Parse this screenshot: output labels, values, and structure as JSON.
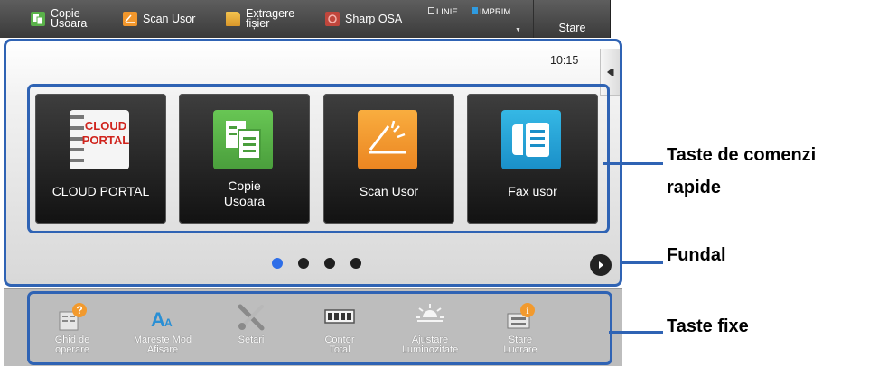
{
  "topbar": {
    "copy_label": "Copie\nUsoara",
    "scan_label": "Scan Usor",
    "extract_label": "Extragere\nfișier",
    "sharp_label": "Sharp OSA",
    "line_label": "LINIE",
    "print_label": "IMPRIM.",
    "status_label": "Stare"
  },
  "home": {
    "clock": "10:15",
    "tiles": [
      {
        "label": "CLOUD PORTAL",
        "icon": "cloud-portal-icon"
      },
      {
        "label": "Copie\nUsoara",
        "icon": "copy-icon"
      },
      {
        "label": "Scan Usor",
        "icon": "scan-icon"
      },
      {
        "label": "Fax usor",
        "icon": "fax-icon"
      }
    ],
    "cloud_logo_text": "CLOUD\nPORTAL",
    "pages": 4,
    "active_page": 1
  },
  "fixed_keys": [
    {
      "label": "Ghid de\noperare",
      "icon": "help-guide-icon"
    },
    {
      "label": "Mareste Mod\nAfisare",
      "icon": "zoom-text-icon"
    },
    {
      "label": "Setari",
      "icon": "settings-tools-icon"
    },
    {
      "label": "Contor\nTotal",
      "icon": "counter-icon"
    },
    {
      "label": "Ajustare\nLuminozitate",
      "icon": "brightness-icon"
    },
    {
      "label": "Stare\nLucrare",
      "icon": "job-status-icon"
    }
  ],
  "callouts": {
    "shortcut_keys_line1": "Taste de comenzi",
    "shortcut_keys_line2": "rapide",
    "background": "Fundal",
    "fixed_keys": "Taste fixe"
  },
  "colors": {
    "highlight_blue": "#2f63b4",
    "copy_green": "#5ab24a",
    "scan_orange": "#f2972c",
    "fax_blue": "#1a8fc8",
    "page_dot_active": "#2e6ee8"
  }
}
